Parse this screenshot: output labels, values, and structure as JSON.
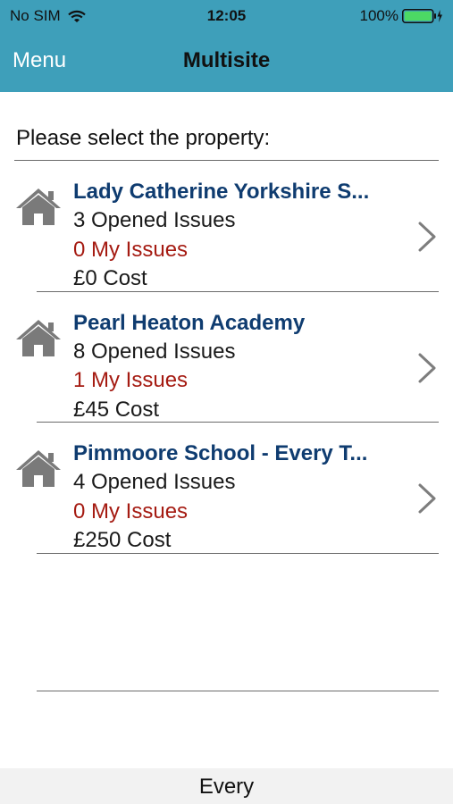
{
  "status_bar": {
    "carrier": "No SIM",
    "time": "12:05",
    "battery": "100%"
  },
  "nav": {
    "menu_label": "Menu",
    "title": "Multisite"
  },
  "prompt": "Please select the property:",
  "properties": [
    {
      "name": "Lady Catherine Yorkshire S...",
      "opened": "3 Opened Issues",
      "my_issues": "0 My Issues",
      "cost": "£0 Cost"
    },
    {
      "name": "Pearl Heaton Academy",
      "opened": "8 Opened Issues",
      "my_issues": "1 My Issues",
      "cost": "£45 Cost"
    },
    {
      "name": "Pimmoore School - Every T...",
      "opened": "4 Opened Issues",
      "my_issues": "0 My Issues",
      "cost": "£250 Cost"
    }
  ],
  "footer": "Every",
  "colors": {
    "header": "#3e9fba",
    "property_name": "#0f3c70",
    "my_issues": "#a51b12",
    "battery": "#4cd964"
  },
  "icons": {
    "property": "house-icon",
    "row_action": "chevron-right-icon",
    "signal": "wifi-icon",
    "power": "battery-icon"
  }
}
